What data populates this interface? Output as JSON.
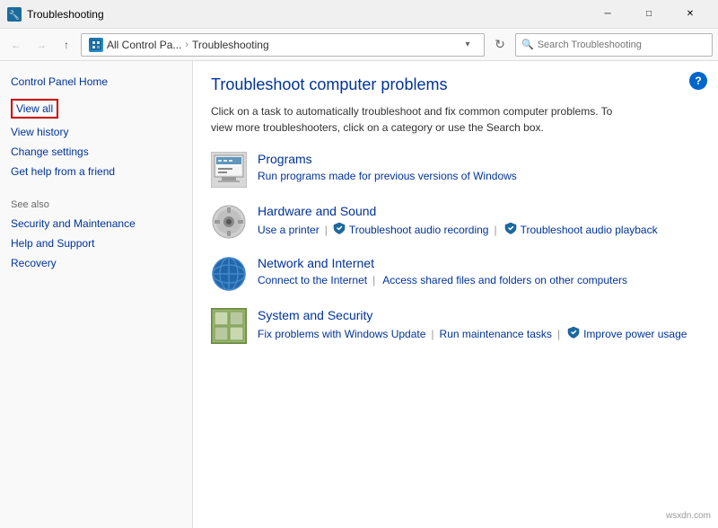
{
  "titleBar": {
    "icon": "🛠",
    "title": "Troubleshooting",
    "minimizeLabel": "─",
    "maximizeLabel": "□",
    "closeLabel": "✕"
  },
  "addressBar": {
    "backTooltip": "Back",
    "forwardTooltip": "Forward",
    "upTooltip": "Up",
    "addressIconAlt": "Control Panel",
    "addressShort": "All Control Pa...",
    "separator": "›",
    "currentPage": "Troubleshooting",
    "dropdownLabel": "▾",
    "refreshLabel": "↻",
    "searchPlaceholder": "Search Troubleshooting"
  },
  "sidebar": {
    "homeLabel": "Control Panel Home",
    "links": [
      {
        "id": "view-all",
        "label": "View all",
        "highlighted": true
      },
      {
        "id": "view-history",
        "label": "View history",
        "highlighted": false
      },
      {
        "id": "change-settings",
        "label": "Change settings",
        "highlighted": false
      },
      {
        "id": "get-help",
        "label": "Get help from a friend",
        "highlighted": false
      }
    ],
    "seeAlsoTitle": "See also",
    "seeAlsoLinks": [
      {
        "id": "security",
        "label": "Security and Maintenance"
      },
      {
        "id": "help",
        "label": "Help and Support"
      },
      {
        "id": "recovery",
        "label": "Recovery"
      }
    ]
  },
  "content": {
    "title": "Troubleshoot computer problems",
    "description": "Click on a task to automatically troubleshoot and fix common computer problems. To view more troubleshooters, click on a category or use the Search box.",
    "helpButtonLabel": "?",
    "categories": [
      {
        "id": "programs",
        "title": "Programs",
        "iconType": "programs",
        "links": [
          {
            "id": "prog-link-1",
            "label": "Run programs made for previous versions of Windows"
          }
        ]
      },
      {
        "id": "hardware",
        "title": "Hardware and Sound",
        "iconType": "hardware",
        "links": [
          {
            "id": "hw-link-1",
            "label": "Use a printer",
            "hasShield": false
          },
          {
            "id": "hw-link-2",
            "label": "Troubleshoot audio recording",
            "hasShield": true
          },
          {
            "id": "hw-link-3",
            "label": "Troubleshoot audio playback",
            "hasShield": true
          }
        ]
      },
      {
        "id": "network",
        "title": "Network and Internet",
        "iconType": "network",
        "links": [
          {
            "id": "net-link-1",
            "label": "Connect to the Internet",
            "hasShield": false
          },
          {
            "id": "net-link-2",
            "label": "Access shared files and folders on other computers",
            "hasShield": false
          }
        ]
      },
      {
        "id": "system",
        "title": "System and Security",
        "iconType": "system",
        "links": [
          {
            "id": "sys-link-1",
            "label": "Fix problems with Windows Update",
            "hasShield": false
          },
          {
            "id": "sys-link-2",
            "label": "Run maintenance tasks",
            "hasShield": false
          },
          {
            "id": "sys-link-3",
            "label": "Improve power usage",
            "hasShield": true
          }
        ]
      }
    ],
    "watermark": "wsxdn.com"
  }
}
